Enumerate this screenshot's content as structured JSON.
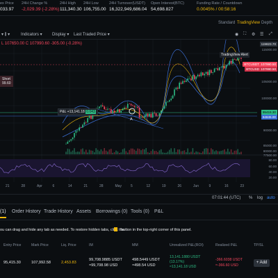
{
  "ticker": {
    "mark_price": {
      "label": "ex Price",
      "value": "033.97"
    },
    "change": {
      "label": "24H Change %",
      "value": "-2,029.39 (-2.28%)"
    },
    "high": {
      "label": "24H High",
      "value": "111,340.30"
    },
    "low": {
      "label": "24H Low",
      "value": "106,755.00"
    },
    "turnover": {
      "label": "24H Turnover(USDT)",
      "value": "16,322,949,686.04"
    },
    "open_interest": {
      "label": "Open Interest(BTC)",
      "value": "54,698.827"
    },
    "funding": {
      "label": "Funding Rate / Countdown",
      "value": "0.0045% / 00:58:16"
    }
  },
  "view_options": [
    "Standard",
    "TradingView",
    "Depth"
  ],
  "active_view": "TradingView",
  "toolbar": {
    "indicators": "Indicators",
    "display": "Display",
    "last_traded": "Last Traded Price"
  },
  "chart_info": {
    "ohlc": "L 107650.00  C 107990.60  -305.00 (-0.28%)",
    "short_label": "Short",
    "short_value": "99.60",
    "pnl_label": "P&L +13,141.18",
    "pnl_qty": "0.043",
    "marker_label": "A",
    "alert_label": "TradingView Alert"
  },
  "price_tags": {
    "top": "119823.70",
    "btcusdt": "107990.50",
    "btcusd": "107990.50",
    "btcusdt_tag": "BTCUSDT",
    "btcusd_tag": "BTCUSD",
    "entry": "95415.30",
    "liq": "94845.00"
  },
  "y_axis": [
    "115000.00",
    "110000.00",
    "105000.00",
    "100000.00",
    "95000.00",
    "90000.00",
    "85000.00",
    "80000.00",
    "77500.00"
  ],
  "rsi_axis": [
    "80.00",
    "60.00",
    "40.00",
    "20.00"
  ],
  "x_axis": [
    "21",
    "28",
    "Apr",
    "6",
    "14",
    "21",
    "28",
    "May",
    "5",
    "12",
    "19",
    "26",
    "Jun",
    "9",
    "16",
    "23"
  ],
  "chart_footer": {
    "time": "07:01:44 (UTC)",
    "pct": "%",
    "log": "log",
    "auto": "auto"
  },
  "tabs": [
    "Positions(1)",
    "Order History",
    "Trade History",
    "Assets",
    "Borrowings (0)",
    "Tools (0)",
    "P&L"
  ],
  "tab_first_visible": "(1)",
  "hint": "ou can drag and hide any tab as needed. To restore hidden tabs, click the",
  "hint_tail": "button in the top-right corner of this panel.",
  "positions": {
    "headers": [
      "Entry Price",
      "Mark Price",
      "Liq. Price",
      "IM",
      "MM",
      "Unrealized P&L(ROI)",
      "Realized P&L",
      "TP/SL"
    ],
    "row": {
      "entry": "95,415.30",
      "mark": "107,992.58",
      "liq": "2,453.83",
      "im": "99,708.9885 USDT",
      "im_sub": "≈99,708.98 USD",
      "mm": "498.5449 USDT",
      "mm_sub": "≈498.54 USD",
      "upnl": "13,141.1880 USDT",
      "upnl_roi": "(13.17%)",
      "upnl_sub": "≈13,141.18 USD",
      "rpnl": "-366.6038 USDT",
      "rpnl_sub": "≈-366.60 USD",
      "add": "+ Add"
    }
  },
  "colors": {
    "accent": "#f0b90b",
    "up": "#2ebd85",
    "down": "#f6465d",
    "bg": "#0b0e11"
  }
}
